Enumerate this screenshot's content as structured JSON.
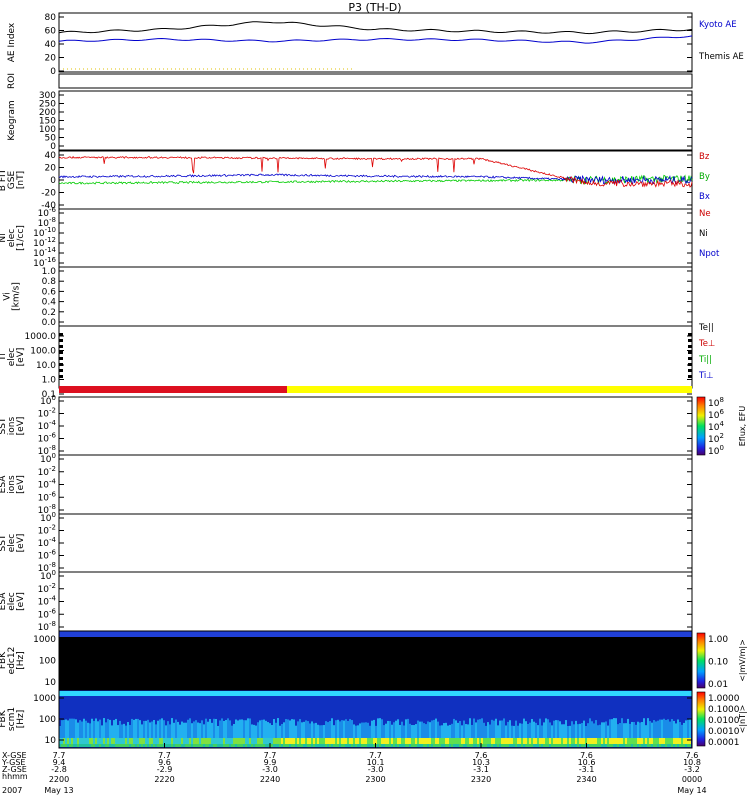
{
  "title": "P3 (TH-D)",
  "xaxis": {
    "row_labels": [
      "X-GSE",
      "Y-GSE",
      "Z-GSE",
      "hhmm",
      "2007"
    ],
    "ticks": [
      {
        "x": "7.7",
        "y": "9.4",
        "z": "-2.8",
        "t": "2200",
        "d": "May 13"
      },
      {
        "x": "7.7",
        "y": "9.6",
        "z": "-2.9",
        "t": "2220",
        "d": ""
      },
      {
        "x": "7.7",
        "y": "9.9",
        "z": "-3.0",
        "t": "2240",
        "d": ""
      },
      {
        "x": "7.7",
        "y": "10.1",
        "z": "-3.0",
        "t": "2300",
        "d": ""
      },
      {
        "x": "7.6",
        "y": "10.3",
        "z": "-3.1",
        "t": "2320",
        "d": ""
      },
      {
        "x": "7.6",
        "y": "10.6",
        "z": "-3.1",
        "t": "2340",
        "d": ""
      },
      {
        "x": "7.6",
        "y": "10.8",
        "z": "-3.2",
        "t": "0000",
        "d": "May 14"
      }
    ]
  },
  "panels": [
    {
      "id": "ae",
      "ylabel": [
        "AE Index"
      ],
      "ticks": [
        "80",
        "60",
        "40",
        "20",
        "0"
      ],
      "ylim": [
        -5,
        85
      ],
      "legend": [
        {
          "text": "Kyoto AE",
          "color": "#0000cc"
        },
        {
          "text": "Themis AE",
          "color": "#000000"
        }
      ]
    },
    {
      "id": "roi",
      "ylabel": [
        "ROI"
      ],
      "ticks": [],
      "legend": []
    },
    {
      "id": "keogram",
      "ylabel": [
        "Keogram"
      ],
      "ticks": [
        "300",
        "250",
        "200",
        "150",
        "100",
        "50",
        "0"
      ],
      "ylim": [
        0,
        300
      ],
      "legend": []
    },
    {
      "id": "bfit",
      "ylabel": [
        "B FIT",
        "GSE",
        "[nT]"
      ],
      "ticks": [
        "40",
        "20",
        "0",
        "-20",
        "-40"
      ],
      "ylim": [
        -45,
        45
      ],
      "legend": [
        {
          "text": "Bz",
          "color": "#cc0000"
        },
        {
          "text": "By",
          "color": "#00aa00"
        },
        {
          "text": "Bx",
          "color": "#0000cc"
        }
      ]
    },
    {
      "id": "ni",
      "ylabel": [
        "Ni",
        "elec",
        "[1/cc]"
      ],
      "ticks": [
        "10^-6",
        "10^-8",
        "10^-10",
        "10^-12",
        "10^-14",
        "10^-16"
      ],
      "legend": [
        {
          "text": "Ne",
          "color": "#cc0000"
        },
        {
          "text": "Ni",
          "color": "#000000"
        },
        {
          "text": "Npot",
          "color": "#0000cc"
        }
      ]
    },
    {
      "id": "vi",
      "ylabel": [
        "Vi",
        "[km/s]"
      ],
      "ticks": [
        "1.0",
        "0.8",
        "0.6",
        "0.4",
        "0.2",
        "0.0"
      ],
      "legend": []
    },
    {
      "id": "ti",
      "ylabel": [
        "Ti",
        "elec",
        "[eV]"
      ],
      "ticks": [
        "1000.0",
        "100.0",
        "10.0",
        "1.0",
        "0.1"
      ],
      "legend": [
        {
          "text": "Te||",
          "color": "#000000"
        },
        {
          "text": "Te⊥",
          "color": "#cc0000"
        },
        {
          "text": "Ti||",
          "color": "#00aa00"
        },
        {
          "text": "Ti⊥",
          "color": "#0000cc"
        }
      ]
    },
    {
      "id": "sst_ion",
      "ylabel": [
        "SST",
        "ions",
        "[eV]"
      ],
      "ticks": [
        "10^0",
        "10^-2",
        "10^-4",
        "10^-6",
        "10^-8"
      ],
      "colorbar": {
        "title": "Eflux, EFU",
        "ticks": [
          "10^8",
          "10^6",
          "10^4",
          "10^2",
          "10^0"
        ]
      }
    },
    {
      "id": "esa_ion",
      "ylabel": [
        "ESA",
        "ions",
        "[eV]"
      ],
      "ticks": [
        "10^0",
        "10^-2",
        "10^-4",
        "10^-6",
        "10^-8"
      ]
    },
    {
      "id": "sst_elec",
      "ylabel": [
        "SST",
        "elec",
        "[eV]"
      ],
      "ticks": [
        "10^0",
        "10^-2",
        "10^-4",
        "10^-6",
        "10^-8"
      ]
    },
    {
      "id": "esa_elec",
      "ylabel": [
        "ESA",
        "elec",
        "[eV]"
      ],
      "ticks": [
        "10^0",
        "10^-2",
        "10^-4",
        "10^-6",
        "10^-8"
      ]
    },
    {
      "id": "fbk_edc",
      "ylabel": [
        "FBK",
        "edc12",
        "[Hz]"
      ],
      "ticks": [
        "1000",
        "100",
        "10"
      ],
      "colorbar": {
        "title": "<|mV/m|>",
        "ticks": [
          "1.00",
          "0.10",
          "0.01"
        ]
      }
    },
    {
      "id": "fbk_scm",
      "ylabel": [
        "FBK",
        "scm1",
        "[Hz]"
      ],
      "ticks": [
        "1000",
        "100",
        "10"
      ],
      "colorbar": {
        "title": "<|nT|>",
        "ticks": [
          "1.0000",
          "0.1000",
          "0.0100",
          "0.0010",
          "0.0001"
        ]
      }
    }
  ],
  "chart_data": [
    {
      "type": "line",
      "title": "AE Index",
      "x": [
        "2200",
        "2220",
        "2240",
        "2300",
        "2320",
        "2340",
        "0000"
      ],
      "series": [
        {
          "name": "Kyoto AE",
          "values": [
            55,
            60,
            72,
            60,
            57,
            55,
            60
          ]
        },
        {
          "name": "Themis AE",
          "values": [
            42,
            45,
            42,
            45,
            44,
            40,
            50
          ]
        }
      ],
      "ylim": [
        -5,
        85
      ]
    },
    {
      "type": "line",
      "title": "B FIT GSE [nT]",
      "x": [
        "2200",
        "2220",
        "2240",
        "2300",
        "2320",
        "2340",
        "0000"
      ],
      "series": [
        {
          "name": "Bz",
          "values": [
            35,
            35,
            34,
            33,
            33,
            -5,
            -6
          ]
        },
        {
          "name": "By",
          "values": [
            -5,
            -4,
            -3,
            -2,
            -1,
            0,
            2
          ]
        },
        {
          "name": "Bx",
          "values": [
            5,
            6,
            8,
            6,
            5,
            0,
            0
          ]
        }
      ],
      "ylim": [
        -45,
        45
      ]
    },
    {
      "type": "heatmap",
      "title": "ROI",
      "bar_segments": [
        {
          "color": "red",
          "from": "2200",
          "to": "2240"
        },
        {
          "color": "yellow",
          "from": "2240",
          "to": "0000"
        }
      ]
    },
    {
      "type": "heatmap",
      "title": "FBK edc12",
      "note_values": "black background, blue band near top"
    },
    {
      "type": "heatmap",
      "title": "FBK scm1",
      "note_values": "blue/cyan with green/yellow at lowest freqs"
    }
  ],
  "colors": {
    "kyoto": "#000000",
    "themis": "#0000cc",
    "bz": "#dd0000",
    "by": "#00cc00",
    "bx": "#0000cc",
    "roi_red": "#dd1020",
    "roi_yellow": "#ffff00"
  }
}
